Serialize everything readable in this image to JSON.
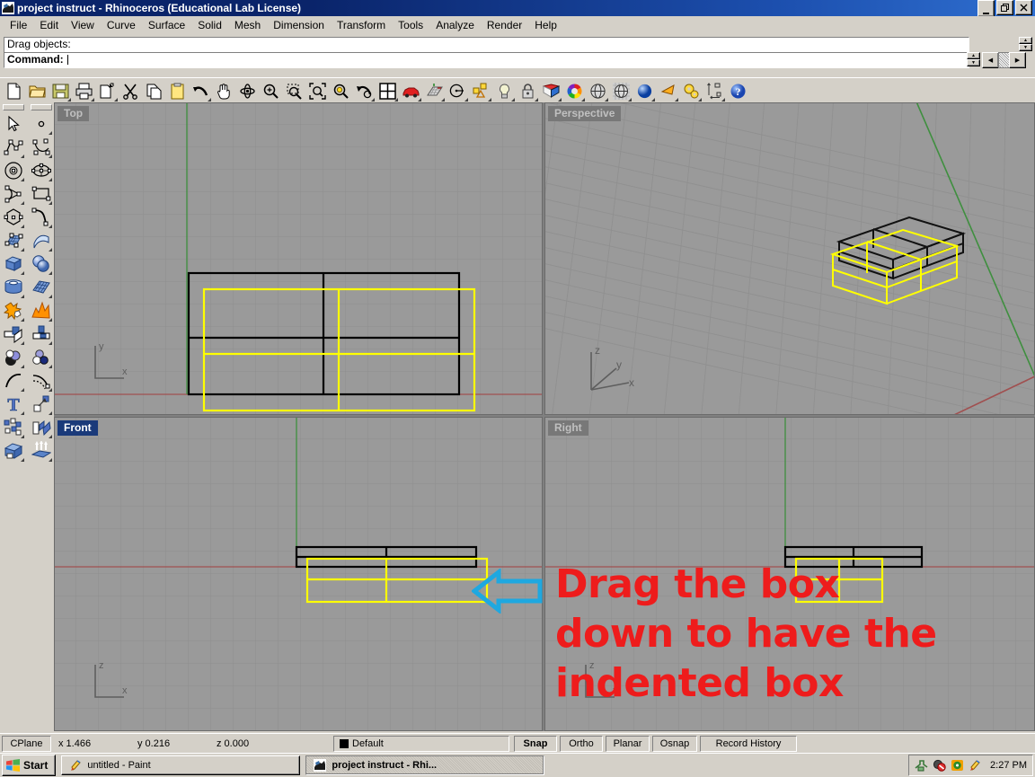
{
  "window": {
    "title": "project instruct - Rhinoceros (Educational Lab License)",
    "icon": "rhino-app-icon",
    "buttons": {
      "minimize": "_",
      "maximize": "❐",
      "close": "✕"
    }
  },
  "menubar": {
    "items": [
      {
        "label": "File"
      },
      {
        "label": "Edit"
      },
      {
        "label": "View"
      },
      {
        "label": "Curve"
      },
      {
        "label": "Surface"
      },
      {
        "label": "Solid"
      },
      {
        "label": "Mesh"
      },
      {
        "label": "Dimension"
      },
      {
        "label": "Transform"
      },
      {
        "label": "Tools"
      },
      {
        "label": "Analyze"
      },
      {
        "label": "Render"
      },
      {
        "label": "Help"
      }
    ]
  },
  "command": {
    "history_line": "Drag objects:",
    "prompt_label": "Command:",
    "input_value": "",
    "input_placeholder": ""
  },
  "main_toolbar": {
    "tools": [
      {
        "name": "new-file-icon",
        "tip": "New"
      },
      {
        "name": "open-folder-icon",
        "tip": "Open"
      },
      {
        "name": "save-icon",
        "tip": "Save"
      },
      {
        "name": "print-icon",
        "tip": "Print"
      },
      {
        "name": "copy-to-clipboard-icon",
        "tip": "Copy to clipboard"
      },
      {
        "name": "cut-scissors-icon",
        "tip": "Cut"
      },
      {
        "name": "copy-icon",
        "tip": "Copy"
      },
      {
        "name": "paste-icon",
        "tip": "Paste"
      },
      {
        "name": "undo-arrow-icon",
        "tip": "Undo"
      },
      {
        "name": "pan-hand-icon",
        "tip": "Pan"
      },
      {
        "name": "rotate-view-icon",
        "tip": "Rotate view"
      },
      {
        "name": "zoom-in-out-icon",
        "tip": "Zoom"
      },
      {
        "name": "zoom-window-icon",
        "tip": "Zoom window"
      },
      {
        "name": "zoom-extents-icon",
        "tip": "Zoom extents"
      },
      {
        "name": "zoom-selected-icon",
        "tip": "Zoom selected"
      },
      {
        "name": "zoom-previous-icon",
        "tip": "Zoom previous"
      },
      {
        "name": "four-viewport-icon",
        "tip": "4 viewports"
      },
      {
        "name": "car-render-icon",
        "tip": "Render preview"
      },
      {
        "name": "grid-plane-icon",
        "tip": "Grid options"
      },
      {
        "name": "named-cplane-icon",
        "tip": "Named CPlanes"
      },
      {
        "name": "layer-yellow-icon",
        "tip": "Layers"
      },
      {
        "name": "light-bulb-icon",
        "tip": "Lights"
      },
      {
        "name": "lock-icon",
        "tip": "Lock object"
      },
      {
        "name": "material-icon",
        "tip": "Material"
      },
      {
        "name": "color-wheel-icon",
        "tip": "Color"
      },
      {
        "name": "wireframe-sphere-icon",
        "tip": "Wireframe display"
      },
      {
        "name": "mesh-sphere-icon",
        "tip": "Shaded display"
      },
      {
        "name": "render-sphere-icon",
        "tip": "Rendered display"
      },
      {
        "name": "ghosted-cone-icon",
        "tip": "Ghosted display"
      },
      {
        "name": "options-gears-icon",
        "tip": "Options"
      },
      {
        "name": "dimension-icon",
        "tip": "Dimension"
      },
      {
        "name": "help-icon",
        "tip": "Help"
      }
    ]
  },
  "left_toolbar": {
    "column1": [
      {
        "name": "select-arrow-icon"
      },
      {
        "name": "polyline-icon"
      },
      {
        "name": "circle-icon"
      },
      {
        "name": "arc-icon"
      },
      {
        "name": "polygon-icon"
      },
      {
        "name": "surface-from-points-icon"
      },
      {
        "name": "box-solid-icon"
      },
      {
        "name": "cylinder-icon"
      },
      {
        "name": "boolean-star-icon"
      },
      {
        "name": "split-icon"
      },
      {
        "name": "boolean-union-icon"
      },
      {
        "name": "fillet-curve-icon"
      },
      {
        "name": "text-tool-icon"
      },
      {
        "name": "array-icon"
      },
      {
        "name": "cap-solid-icon"
      }
    ],
    "column2": [
      {
        "name": "point-icon"
      },
      {
        "name": "control-point-curve-icon"
      },
      {
        "name": "ellipse-icon"
      },
      {
        "name": "rectangle-icon"
      },
      {
        "name": "curve-blend-icon"
      },
      {
        "name": "sweep-surface-icon"
      },
      {
        "name": "sphere-icon"
      },
      {
        "name": "surface-grid-icon"
      },
      {
        "name": "explode-icon"
      },
      {
        "name": "trim-icon"
      },
      {
        "name": "boolean-difference-icon"
      },
      {
        "name": "offset-curve-icon"
      },
      {
        "name": "scale-icon"
      },
      {
        "name": "extrude-icon"
      },
      {
        "name": "extrude-up-icon"
      }
    ]
  },
  "viewports": [
    {
      "id": "top",
      "label": "Top",
      "active": false,
      "axis": "xy"
    },
    {
      "id": "perspective",
      "label": "Perspective",
      "active": false,
      "axis": "xyz"
    },
    {
      "id": "front",
      "label": "Front",
      "active": true,
      "axis": "xz"
    },
    {
      "id": "right",
      "label": "Right",
      "active": false,
      "axis": "xz"
    }
  ],
  "annotation": {
    "text": "Drag the box\ndown to have the\nindented box",
    "color": "#ee1c1c",
    "arrow_name": "left-pointing-arrow",
    "arrow_color": "#1fa8e0"
  },
  "statusbar": {
    "cplane_label": "CPlane",
    "x": "x 1.466",
    "y": "y 0.216",
    "z": "z 0.000",
    "layer": "Default",
    "layer_color": "#000000",
    "toggles": [
      {
        "label": "Snap",
        "on": true
      },
      {
        "label": "Ortho",
        "on": false
      },
      {
        "label": "Planar",
        "on": false
      },
      {
        "label": "Osnap",
        "on": false
      },
      {
        "label": "Record History",
        "on": false
      }
    ]
  },
  "taskbar": {
    "start_label": "Start",
    "tasks": [
      {
        "label": "untitled - Paint",
        "icon": "paint-icon",
        "active": false
      },
      {
        "label": "project instruct - Rhi...",
        "icon": "rhino-app-icon",
        "active": true
      }
    ],
    "tray_icons": [
      "network-icon",
      "antivirus-icon",
      "media-icon",
      "paint-tray-icon"
    ],
    "clock": "2:27 PM"
  },
  "colors": {
    "viewport_bg": "#9a9a9a",
    "grid_line": "#8f8f8f",
    "grid_major": "#858585",
    "axis_x": "#a04040",
    "axis_y": "#3f8b3f",
    "selected_object": "#ffff00",
    "object_wire": "#000000",
    "title_blue": "#0a246a",
    "chrome": "#d4d0c8"
  }
}
